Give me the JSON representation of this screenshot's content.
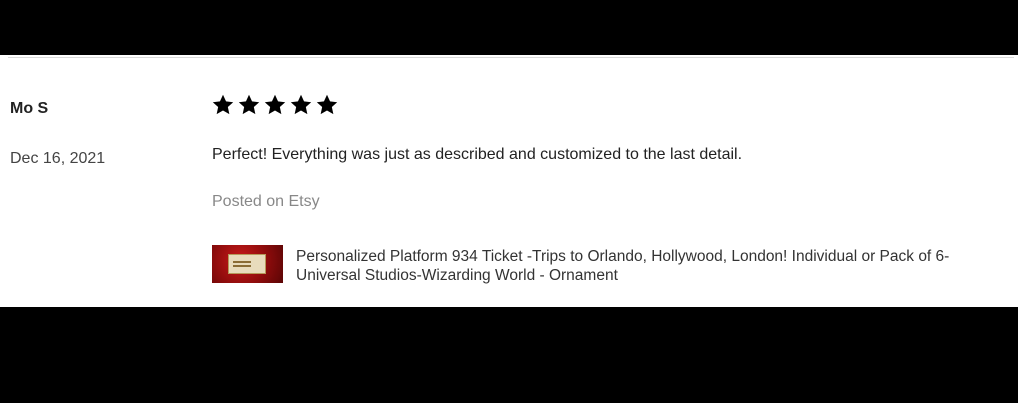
{
  "review": {
    "reviewer_name": "Mo S",
    "date": "Dec 16, 2021",
    "rating": 5,
    "rating_max": 5,
    "text": "Perfect! Everything was just as described and customized to the last detail.",
    "posted_on": "Posted on Etsy"
  },
  "product": {
    "title": "Personalized Platform 934 Ticket -Trips to Orlando, Hollywood, London! Individual or Pack of 6- Universal Studios-Wizarding World - Ornament"
  },
  "colors": {
    "star": "#000000",
    "background": "#ffffff",
    "letterbox": "#000000"
  }
}
